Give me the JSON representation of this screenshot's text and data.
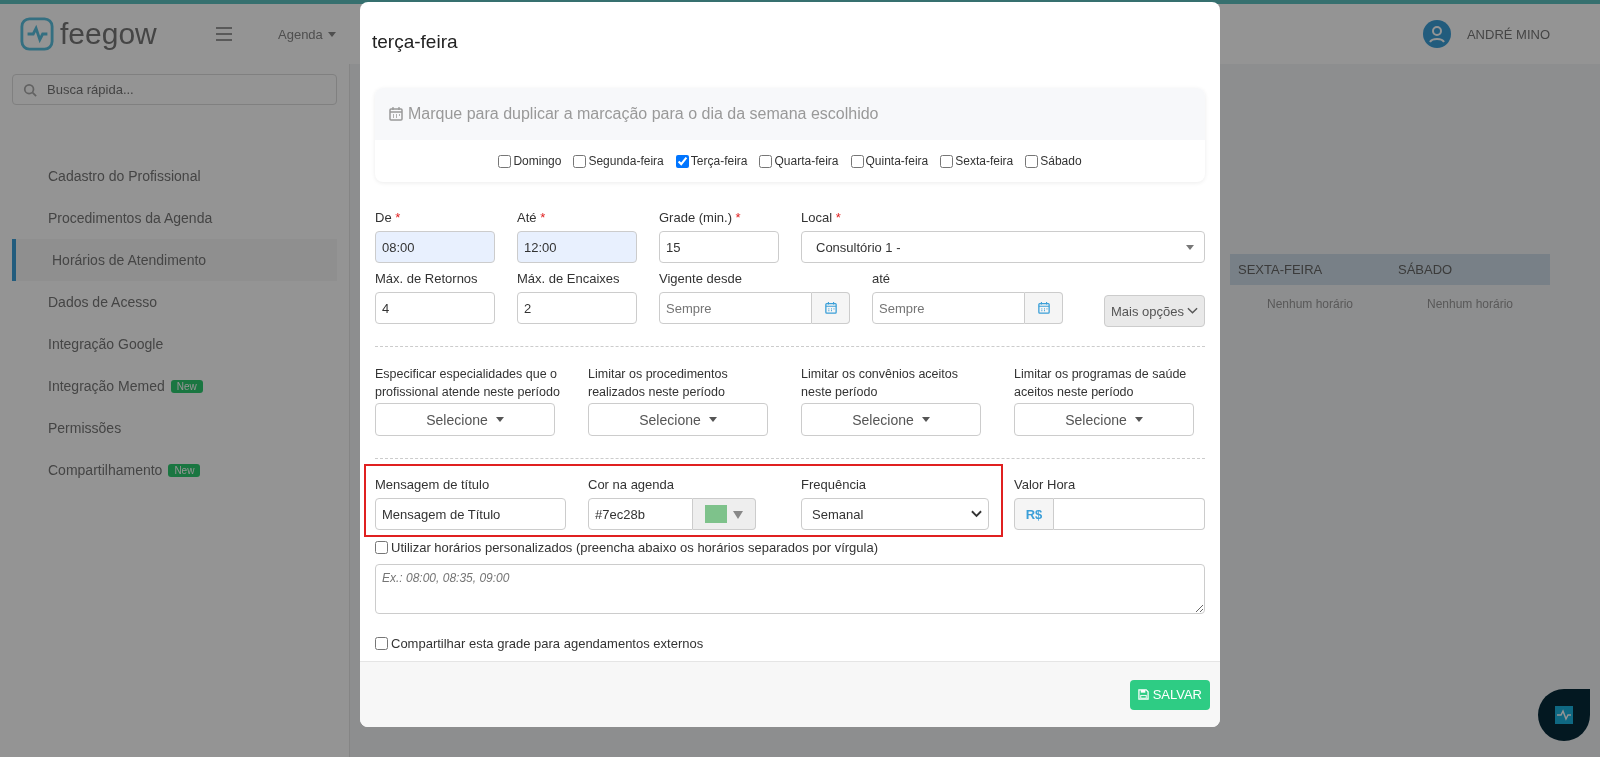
{
  "app": {
    "logo": "feegow",
    "nav": "Agenda",
    "search": {
      "placeholder": "Busca rápida..."
    },
    "user": "ANDRÉ MINO",
    "sidebar": [
      {
        "label": "Cadastro do Profissional",
        "selected": false
      },
      {
        "label": "Procedimentos da Agenda",
        "selected": false
      },
      {
        "label": "Horários de Atendimento",
        "selected": true
      },
      {
        "label": "Dados de Acesso",
        "selected": false
      },
      {
        "label": "Integração Google",
        "selected": false
      },
      {
        "label": "Integração Memed",
        "selected": false,
        "badge": "New"
      },
      {
        "label": "Permissões",
        "selected": false
      },
      {
        "label": "Compartilhamento",
        "selected": false,
        "badge": "New"
      }
    ],
    "day_headers": [
      "SEXTA-FEIRA",
      "SÁBADO"
    ],
    "empty_cells": [
      "Nenhum horário",
      "Nenhum horário"
    ]
  },
  "modal": {
    "title": "terça-feira",
    "duplicate": {
      "hint": "Marque para duplicar a marcação para o dia da semana escolhido",
      "days": [
        {
          "label": "Domingo",
          "checked": false
        },
        {
          "label": "Segunda-feira",
          "checked": false
        },
        {
          "label": "Terça-feira",
          "checked": true
        },
        {
          "label": "Quarta-feira",
          "checked": false
        },
        {
          "label": "Quinta-feira",
          "checked": false
        },
        {
          "label": "Sexta-feira",
          "checked": false
        },
        {
          "label": "Sábado",
          "checked": false
        }
      ]
    },
    "row1": [
      {
        "label": "De",
        "mark": "*",
        "value": "08:00",
        "kind": "time"
      },
      {
        "label": "Até",
        "mark": "*",
        "value": "12:00",
        "kind": "time"
      },
      {
        "label": "Grade (min.)",
        "mark": "*",
        "value": "15",
        "kind": "text"
      },
      {
        "label": "Local",
        "mark": "*",
        "value": "Consultório 1 -",
        "kind": "select"
      }
    ],
    "row2": [
      {
        "label": "Máx. de Retornos",
        "value": "4",
        "kind": "text"
      },
      {
        "label": "Máx. de Encaixes",
        "value": "2",
        "kind": "text"
      },
      {
        "label": "Vigente desde",
        "placeholder": "Sempre",
        "kind": "date"
      },
      {
        "label": "até",
        "placeholder": "Sempre",
        "kind": "date"
      }
    ],
    "more_button": "Mais opções",
    "limits": [
      {
        "label": "Especificar especialidades que o profissional atende neste período",
        "button": "Selecione"
      },
      {
        "label": "Limitar os procedimentos realizados neste período",
        "button": "Selecione"
      },
      {
        "label": "Limitar os convênios aceitos neste período",
        "button": "Selecione"
      },
      {
        "label": "Limitar os programas de saúde aceitos neste período",
        "button": "Selecione"
      }
    ],
    "title_message": {
      "label": "Mensagem de título",
      "value": "Mensagem de Título"
    },
    "color": {
      "label": "Cor na agenda",
      "value": "#7ec28b",
      "color": "#7ec28b"
    },
    "frequency": {
      "label": "Frequência",
      "value": "Semanal"
    },
    "hourly_rate": {
      "label": "Valor Hora",
      "prefix": "R$"
    },
    "custom_times": {
      "label": "Utilizar horários personalizados (preencha abaixo os horários separados por vírgula)",
      "checked": false,
      "placeholder": "Ex.: 08:00, 08:35, 09:00"
    },
    "share": {
      "label": "Compartilhar esta grade para agendamentos externos",
      "checked": false
    },
    "save_button": "SALVAR"
  }
}
